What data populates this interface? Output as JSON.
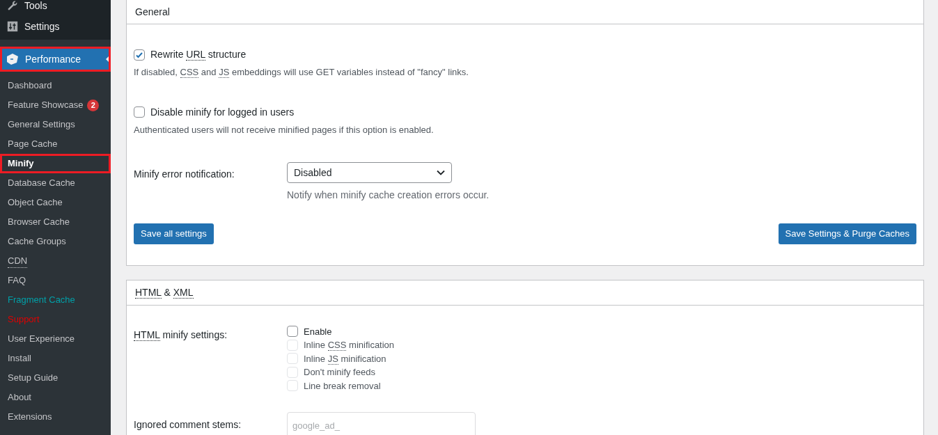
{
  "sidebar": {
    "menu": [
      {
        "label": "Tools"
      },
      {
        "label": "Settings"
      }
    ],
    "plugin": {
      "label": "Performance",
      "selected": true,
      "highlighted": true
    },
    "submenu": [
      {
        "label": "Dashboard",
        "selected": false,
        "highlighted": false
      },
      {
        "label": "Feature Showcase",
        "selected": false,
        "highlighted": false,
        "badge": "2"
      },
      {
        "label": "General Settings",
        "selected": false,
        "highlighted": false
      },
      {
        "label": "Page Cache",
        "selected": false,
        "highlighted": false
      },
      {
        "label": "Minify",
        "selected": true,
        "highlighted": true
      },
      {
        "label": "Database Cache",
        "selected": false,
        "highlighted": false
      },
      {
        "label": "Object Cache",
        "selected": false,
        "highlighted": false
      },
      {
        "label": "Browser Cache",
        "selected": false,
        "highlighted": false
      },
      {
        "label": "Cache Groups",
        "selected": false,
        "highlighted": false
      },
      {
        "label": "CDN",
        "selected": false,
        "highlighted": false,
        "abbr": true
      },
      {
        "label": "FAQ",
        "selected": false,
        "highlighted": false
      },
      {
        "label": "Fragment Cache",
        "selected": false,
        "highlighted": false,
        "color": "#00a0a8"
      },
      {
        "label": "Support",
        "selected": false,
        "highlighted": false,
        "color": "#e00000"
      },
      {
        "label": "User Experience",
        "selected": false,
        "highlighted": false
      },
      {
        "label": "Install",
        "selected": false,
        "highlighted": false
      },
      {
        "label": "Setup Guide",
        "selected": false,
        "highlighted": false
      },
      {
        "label": "About",
        "selected": false,
        "highlighted": false
      },
      {
        "label": "Extensions",
        "selected": false,
        "highlighted": false
      }
    ]
  },
  "general": {
    "title": [
      {
        "text": "General"
      }
    ],
    "options": [
      {
        "kind": "checkbox",
        "checked": true,
        "label": [
          {
            "text": "Rewrite "
          },
          {
            "text": "URL",
            "abbr": true
          },
          {
            "text": " structure"
          }
        ],
        "description": [
          {
            "text": "If disabled, "
          },
          {
            "text": "CSS",
            "abbr": true
          },
          {
            "text": " and "
          },
          {
            "text": "JS",
            "abbr": true
          },
          {
            "text": " embeddings will use GET variables instead of \"fancy\" links."
          }
        ]
      },
      {
        "kind": "checkbox",
        "checked": false,
        "label": [
          {
            "text": "Disable minify for logged in users"
          }
        ],
        "description": [
          {
            "text": "Authenticated users will not receive minified pages if this option is enabled."
          }
        ]
      },
      {
        "kind": "select",
        "label": [
          {
            "text": "Minify error notification:"
          }
        ],
        "value": "Disabled",
        "description": [
          {
            "text": "Notify when minify cache creation errors occur."
          }
        ]
      }
    ],
    "buttons": [
      "Save all settings",
      "Save Settings & Purge Caches"
    ]
  },
  "html_xml": {
    "title": [
      {
        "text": "HTML",
        "abbr": true
      },
      {
        "text": " & "
      },
      {
        "text": "XML",
        "abbr": true
      }
    ],
    "settings_label": [
      {
        "text": "HTML",
        "abbr": true
      },
      {
        "text": " minify settings:"
      }
    ],
    "checkboxes": [
      {
        "label": [
          {
            "text": "Enable"
          }
        ],
        "checked": false,
        "disabled": false
      },
      {
        "label": [
          {
            "text": "Inline "
          },
          {
            "text": "CSS",
            "abbr": true
          },
          {
            "text": " minification"
          }
        ],
        "checked": false,
        "disabled": true
      },
      {
        "label": [
          {
            "text": "Inline "
          },
          {
            "text": "JS",
            "abbr": true
          },
          {
            "text": " minification"
          }
        ],
        "checked": false,
        "disabled": true
      },
      {
        "label": [
          {
            "text": "Don't minify feeds"
          }
        ],
        "checked": false,
        "disabled": true
      },
      {
        "label": [
          {
            "text": "Line break removal"
          }
        ],
        "checked": false,
        "disabled": true
      }
    ],
    "stems_label": [
      {
        "text": "Ignored comment stems:"
      }
    ],
    "stems_placeholder": "google_ad_"
  }
}
